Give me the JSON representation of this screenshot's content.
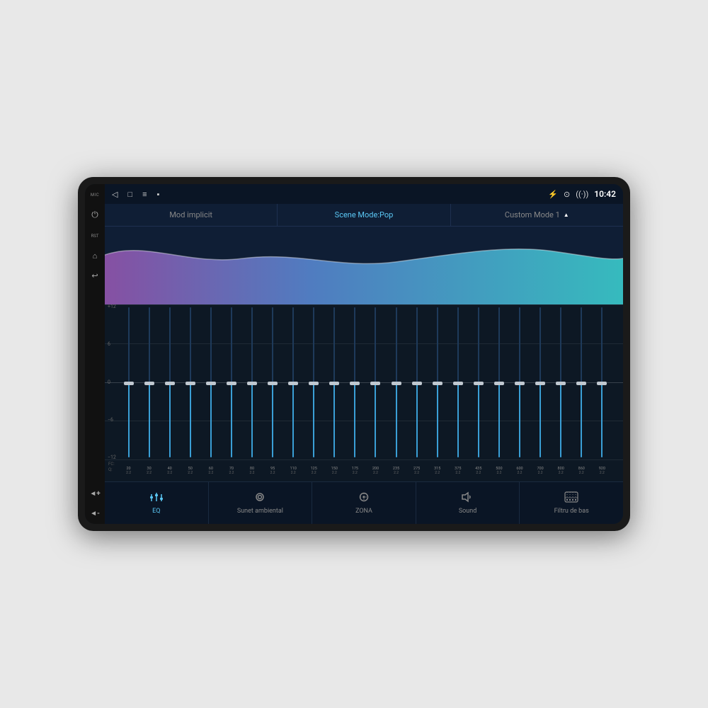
{
  "device": {
    "status_bar": {
      "time": "10:42",
      "icons": [
        "bluetooth",
        "location",
        "wifi"
      ]
    },
    "mode_bar": {
      "items": [
        {
          "label": "Mod implicit",
          "active": false
        },
        {
          "label": "Scene Mode:Pop",
          "active": true
        },
        {
          "label": "Custom Mode 1",
          "active": false,
          "has_triangle": true
        }
      ]
    },
    "eq": {
      "scale_labels": [
        "+12",
        "6",
        "0",
        "−6",
        "−12"
      ],
      "bands": [
        {
          "fc": "20",
          "q": "2.2",
          "value": 50
        },
        {
          "fc": "30",
          "q": "2.2",
          "value": 50
        },
        {
          "fc": "40",
          "q": "2.2",
          "value": 50
        },
        {
          "fc": "50",
          "q": "2.2",
          "value": 50
        },
        {
          "fc": "60",
          "q": "2.2",
          "value": 50
        },
        {
          "fc": "70",
          "q": "2.2",
          "value": 50
        },
        {
          "fc": "80",
          "q": "2.2",
          "value": 50
        },
        {
          "fc": "95",
          "q": "2.2",
          "value": 50
        },
        {
          "fc": "110",
          "q": "2.2",
          "value": 50
        },
        {
          "fc": "125",
          "q": "2.2",
          "value": 50
        },
        {
          "fc": "150",
          "q": "2.2",
          "value": 50
        },
        {
          "fc": "175",
          "q": "2.2",
          "value": 50
        },
        {
          "fc": "200",
          "q": "2.2",
          "value": 50
        },
        {
          "fc": "235",
          "q": "2.2",
          "value": 50
        },
        {
          "fc": "275",
          "q": "2.2",
          "value": 50
        },
        {
          "fc": "315",
          "q": "2.2",
          "value": 50
        },
        {
          "fc": "375",
          "q": "2.2",
          "value": 50
        },
        {
          "fc": "435",
          "q": "2.2",
          "value": 50
        },
        {
          "fc": "500",
          "q": "2.2",
          "value": 50
        },
        {
          "fc": "600",
          "q": "2.2",
          "value": 50
        },
        {
          "fc": "700",
          "q": "2.2",
          "value": 50
        },
        {
          "fc": "800",
          "q": "2.2",
          "value": 50
        },
        {
          "fc": "860",
          "q": "2.2",
          "value": 50
        },
        {
          "fc": "920",
          "q": "2.2",
          "value": 50
        }
      ]
    },
    "bottom_nav": {
      "items": [
        {
          "label": "EQ",
          "icon": "eq",
          "active": true
        },
        {
          "label": "Sunet ambiental",
          "icon": "ambient",
          "active": false
        },
        {
          "label": "ZONA",
          "icon": "zone",
          "active": false
        },
        {
          "label": "Sound",
          "icon": "sound",
          "active": false
        },
        {
          "label": "Filtru de bas",
          "icon": "bass",
          "active": false
        }
      ]
    }
  }
}
